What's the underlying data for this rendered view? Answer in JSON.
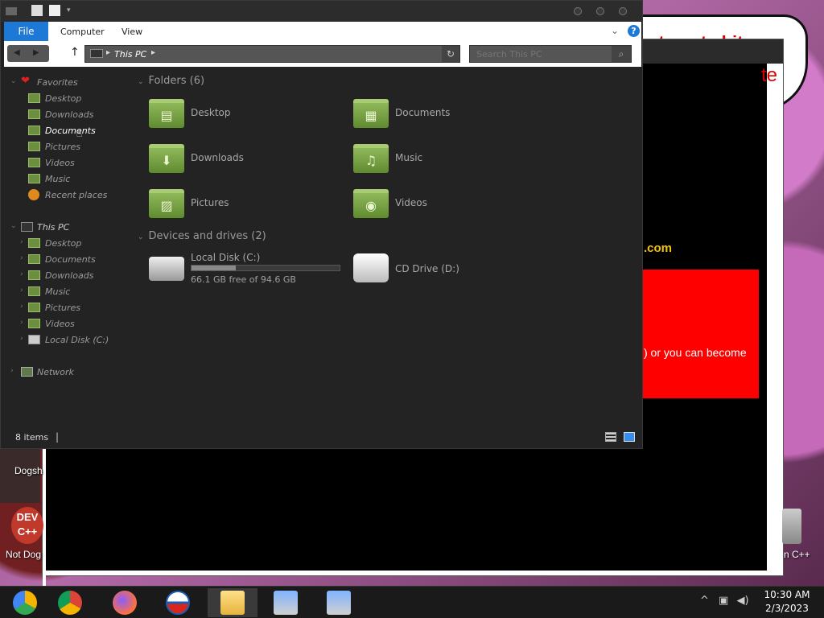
{
  "background": {
    "speech_text_1": "e to get shit",
    "speech_text_2": "te",
    "dotcom": ".com",
    "red_box_text": ") or you can become",
    "desktop_icons": {
      "dogs_label": "Dogsh",
      "not_dog_label": "Not Dog",
      "dev_label": "DEV C++",
      "right_label": "n C++"
    }
  },
  "explorer": {
    "ribbon": {
      "file": "File",
      "computer": "Computer",
      "view": "View",
      "help": "?"
    },
    "address": {
      "path": "This PC",
      "chevron": "▸"
    },
    "search": {
      "placeholder": "Search This PC"
    },
    "sidebar": {
      "favorites": {
        "label": "Favorites",
        "items": [
          {
            "label": "Desktop"
          },
          {
            "label": "Downloads"
          },
          {
            "label": "Documents"
          },
          {
            "label": "Pictures"
          },
          {
            "label": "Videos"
          },
          {
            "label": "Music"
          },
          {
            "label": "Recent places"
          }
        ]
      },
      "this_pc": {
        "label": "This PC",
        "items": [
          {
            "label": "Desktop"
          },
          {
            "label": "Documents"
          },
          {
            "label": "Downloads"
          },
          {
            "label": "Music"
          },
          {
            "label": "Pictures"
          },
          {
            "label": "Videos"
          },
          {
            "label": "Local Disk (C:)"
          }
        ]
      },
      "network": {
        "label": "Network"
      }
    },
    "content": {
      "folders_header": "Folders (6)",
      "folders": [
        {
          "label": "Desktop",
          "icon": "desktop-icon"
        },
        {
          "label": "Documents",
          "icon": "documents-icon"
        },
        {
          "label": "Downloads",
          "icon": "downloads-icon"
        },
        {
          "label": "Music",
          "icon": "music-icon"
        },
        {
          "label": "Pictures",
          "icon": "pictures-icon"
        },
        {
          "label": "Videos",
          "icon": "videos-icon"
        }
      ],
      "devices_header": "Devices and drives (2)",
      "drives": [
        {
          "label": "Local Disk (C:)",
          "free": "66.1 GB free of 94.6 GB",
          "used_fraction": 0.3
        },
        {
          "label": "CD Drive (D:)"
        }
      ]
    },
    "status": {
      "items": "8 items",
      "sep": "|"
    }
  },
  "taskbar": {
    "apps": [
      "chrome-canary",
      "chrome",
      "firefox",
      "obama-app",
      "file-explorer",
      "installer-1",
      "installer-2"
    ],
    "time": "10:30 AM",
    "date": "2/3/2023"
  }
}
